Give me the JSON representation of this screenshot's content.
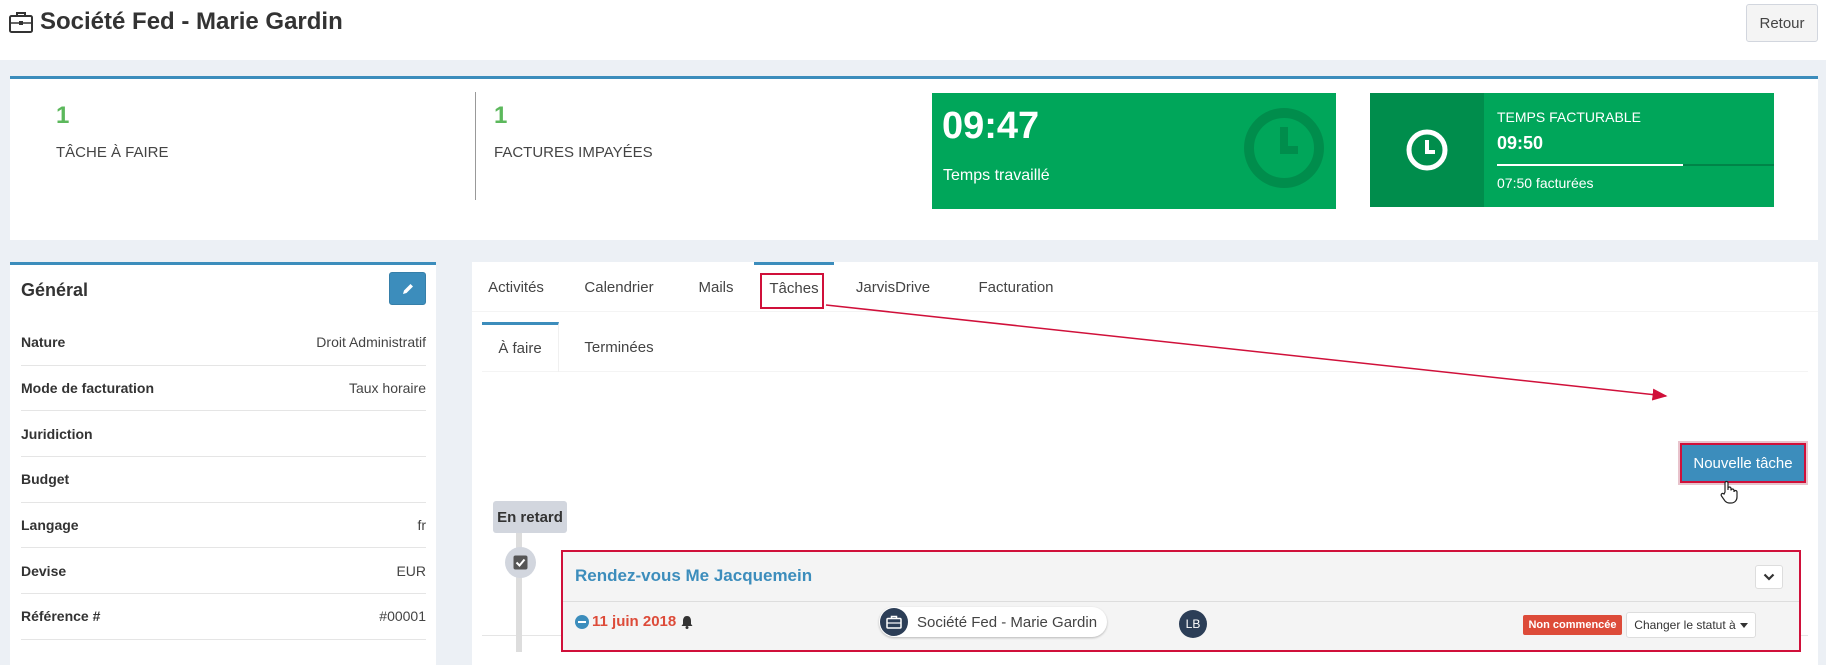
{
  "header": {
    "title": "Société Fed - Marie Gardin",
    "back_label": "Retour"
  },
  "stats": {
    "tasks_count": "1",
    "tasks_label": "TÂCHE À FAIRE",
    "invoices_count": "1",
    "invoices_label": "FACTURES IMPAYÉES",
    "worked_time": "09:47",
    "worked_label": "Temps travaillé",
    "billable_label": "TEMPS FACTURABLE",
    "billable_time": "09:50",
    "billed_label": "07:50 facturées",
    "billed_progress": 0.67
  },
  "general": {
    "title": "Général",
    "rows": [
      {
        "key": "Nature",
        "value": "Droit Administratif"
      },
      {
        "key": "Mode de facturation",
        "value": "Taux horaire"
      },
      {
        "key": "Juridiction",
        "value": ""
      },
      {
        "key": "Budget",
        "value": ""
      },
      {
        "key": "Langage",
        "value": "fr"
      },
      {
        "key": "Devise",
        "value": "EUR"
      },
      {
        "key": "Référence #",
        "value": "#00001"
      }
    ]
  },
  "tabs": [
    "Activités",
    "Calendrier",
    "Mails",
    "Tâches",
    "JarvisDrive",
    "Facturation"
  ],
  "subtabs": [
    "À faire",
    "Terminées"
  ],
  "tasks": {
    "new_task_label": "Nouvelle tâche",
    "late_label": "En retard",
    "task_title": "Rendez-vous Me Jacquemein",
    "task_date": "11 juin 2018",
    "client": "Société Fed - Marie Gardin",
    "assignee_initials": "LB",
    "status": "Non commencée",
    "change_status_label": "Changer le statut à"
  },
  "colors": {
    "primary": "#3c8dbc",
    "success": "#00a65a",
    "danger": "#dd4b39",
    "highlight": "#d0103a"
  }
}
